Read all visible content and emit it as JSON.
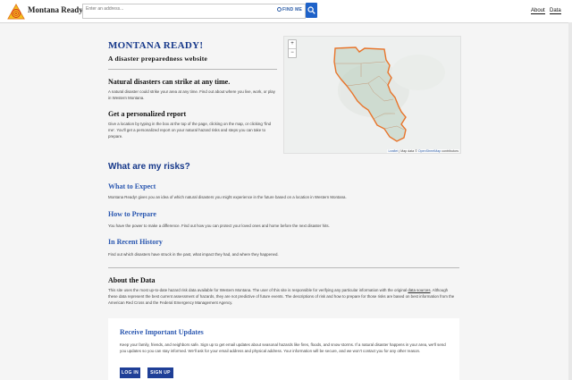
{
  "header": {
    "brand": "Montana Ready!",
    "search_placeholder": "Enter an address...",
    "find_me": "FIND ME",
    "nav": [
      "About",
      "Data"
    ]
  },
  "intro": {
    "title": "MONTANA READY!",
    "subtitle": "A disaster preparedness website",
    "strike_heading": "Natural disasters can strike at any time.",
    "strike_text": "A natural disaster could strike your area at any time. Find out about where you live, work, or play in Western Montana.",
    "report_heading": "Get a personalized report",
    "report_text": "Give a location by typing in the box at the top of the page, clicking on the map, or clicking ‘find me’. You'll get a personalized report on your natural hazard risks and steps you can take to prepare."
  },
  "map": {
    "zoom_in": "+",
    "zoom_out": "−",
    "attribution_leaflet": "Leaflet",
    "attribution_rest": " | Map data © ",
    "attribution_osm": "OpenStreetMap",
    "attribution_tail": " contributors"
  },
  "risks": {
    "title": "What are my risks?",
    "sections": [
      {
        "heading": "What to Expect",
        "text": "Montana Ready! gives you an idea of which natural disasters you might experience in the future based on a location in Western Montana."
      },
      {
        "heading": "How to Prepare",
        "text": "You have the power to make a difference. Find out how you can protect your loved ones and home before the next disaster hits."
      },
      {
        "heading": "In Recent History",
        "text": "Find out which disasters have struck in the past, what impact they had, and where they happened."
      }
    ]
  },
  "about": {
    "title": "About the Data",
    "text_a": "This site uses the most up-to-date hazard risk data available for Western Montana. The user of this site is responsible for verifying any particular information with the original ",
    "link": "data sources",
    "text_b": ". Although these data represent the best current assessment of hazards, they are not predictive of future events. The descriptions of risk and how to prepare for those risks are based on best information from the American Red Cross and the Federal Emergency Management Agency."
  },
  "updates": {
    "title": "Receive Important Updates",
    "text": "Keep your family, friends, and neighbors safe. Sign up to get email updates about seasonal hazards like fires, floods, and snow storms. If a natural disaster happens in your area, we'll send you updates so you can stay informed. We'll ask for your email address and physical address. Your information will be secure, and we won't contact you for any other reason.",
    "login": "LOG IN",
    "signup": "SIGN UP"
  },
  "colors": {
    "brand_blue": "#16388a",
    "link_blue": "#2a57b0",
    "button_blue": "#1f3f97",
    "region_outline": "#e8742a"
  }
}
